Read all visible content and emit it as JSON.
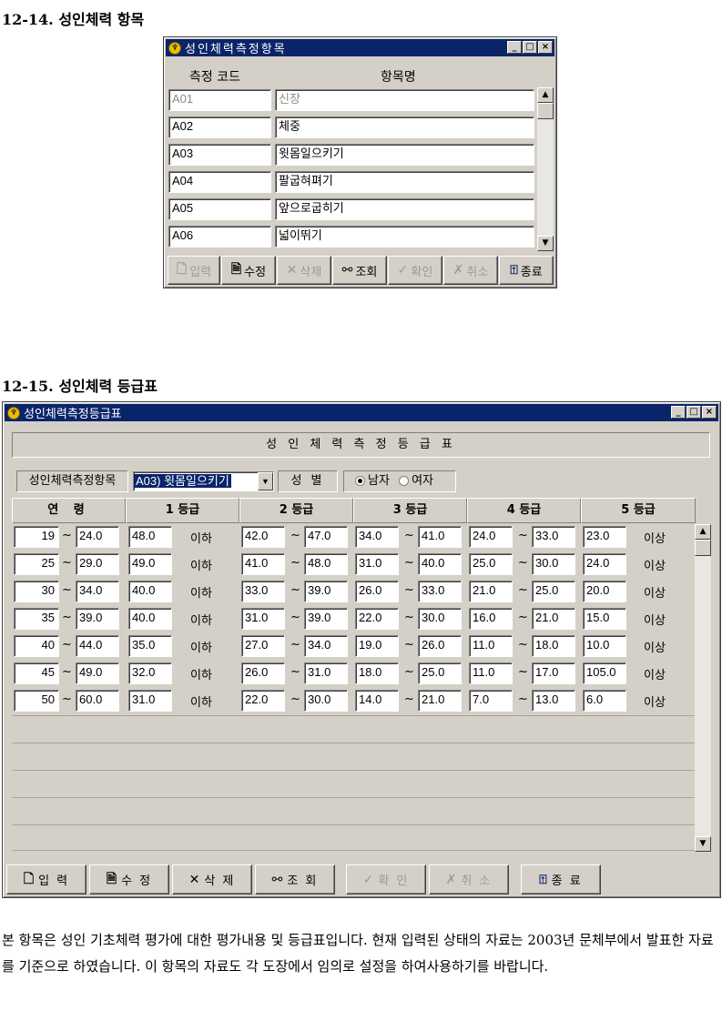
{
  "heading1": "12-14. 성인체력 항목",
  "win1": {
    "title": "성인체력측정항목",
    "col_code": "측정 코드",
    "col_name": "항목명",
    "rows": [
      {
        "code": "A01",
        "name": "신장"
      },
      {
        "code": "A02",
        "name": "체중"
      },
      {
        "code": "A03",
        "name": "윗몸일으키기"
      },
      {
        "code": "A04",
        "name": "팔굽혀펴기"
      },
      {
        "code": "A05",
        "name": "앞으로굽히기"
      },
      {
        "code": "A06",
        "name": "넓이뛰기"
      }
    ],
    "buttons": {
      "input": "입력",
      "edit": "수정",
      "delete": "삭제",
      "search": "조회",
      "confirm": "확인",
      "cancel": "취소",
      "exit": "종료"
    }
  },
  "heading2": "12-15. 성인체력 등급표",
  "win2": {
    "title": "성인체력측정등급표",
    "header_banner": "성 인 체 력 측 정 등 급 표",
    "filter_label": "성인체력측정항목",
    "filter_value": "A03) 윗몸일으키기",
    "gender_label": "성 별",
    "gender_male": "남자",
    "gender_female": "여자",
    "col_age": "연 령",
    "col_g1": "1 등급",
    "col_g2": "2 등급",
    "col_g3": "3 등급",
    "col_g4": "4 등급",
    "col_g5": "5 등급",
    "tilde": "~",
    "below": "이하",
    "above": "이상",
    "rows": [
      {
        "age_from": "19",
        "age_to": "24.0",
        "g1": "48.0",
        "g2_from": "42.0",
        "g2_to": "47.0",
        "g3_from": "34.0",
        "g3_to": "41.0",
        "g4_from": "24.0",
        "g4_to": "33.0",
        "g5": "23.0"
      },
      {
        "age_from": "25",
        "age_to": "29.0",
        "g1": "49.0",
        "g2_from": "41.0",
        "g2_to": "48.0",
        "g3_from": "31.0",
        "g3_to": "40.0",
        "g4_from": "25.0",
        "g4_to": "30.0",
        "g5": "24.0"
      },
      {
        "age_from": "30",
        "age_to": "34.0",
        "g1": "40.0",
        "g2_from": "33.0",
        "g2_to": "39.0",
        "g3_from": "26.0",
        "g3_to": "33.0",
        "g4_from": "21.0",
        "g4_to": "25.0",
        "g5": "20.0"
      },
      {
        "age_from": "35",
        "age_to": "39.0",
        "g1": "40.0",
        "g2_from": "31.0",
        "g2_to": "39.0",
        "g3_from": "22.0",
        "g3_to": "30.0",
        "g4_from": "16.0",
        "g4_to": "21.0",
        "g5": "15.0"
      },
      {
        "age_from": "40",
        "age_to": "44.0",
        "g1": "35.0",
        "g2_from": "27.0",
        "g2_to": "34.0",
        "g3_from": "19.0",
        "g3_to": "26.0",
        "g4_from": "11.0",
        "g4_to": "18.0",
        "g5": "10.0"
      },
      {
        "age_from": "45",
        "age_to": "49.0",
        "g1": "32.0",
        "g2_from": "26.0",
        "g2_to": "31.0",
        "g3_from": "18.0",
        "g3_to": "25.0",
        "g4_from": "11.0",
        "g4_to": "17.0",
        "g5": "105.0"
      },
      {
        "age_from": "50",
        "age_to": "60.0",
        "g1": "31.0",
        "g2_from": "22.0",
        "g2_to": "30.0",
        "g3_from": "14.0",
        "g3_to": "21.0",
        "g4_from": "7.0",
        "g4_to": "13.0",
        "g5": "6.0"
      }
    ],
    "buttons": {
      "input": "입 력",
      "edit": "수 정",
      "delete": "삭 제",
      "search": "조 회",
      "confirm": "확 인",
      "cancel": "취 소",
      "exit": "종 료"
    }
  },
  "paragraph": "본 항목은 성인 기초체력 평가에 대한 평가내용 및 등급표입니다. 현재 입력된 상태의 자료는 2003년 문체부에서 발표한 자료를 기준으로 하였습니다. 이 항목의 자료도 각 도장에서 임의로 설정을 하여사용하기를 바랍니다."
}
